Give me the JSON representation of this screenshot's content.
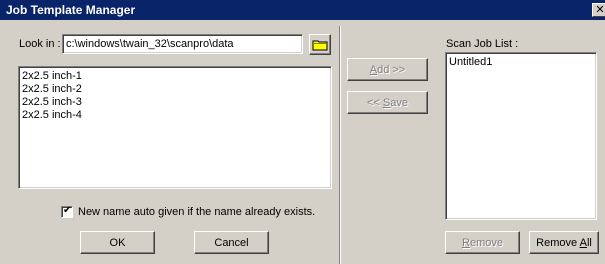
{
  "window": {
    "title": "Job Template Manager",
    "close_glyph": "✕"
  },
  "look_in": {
    "label": "Look in :",
    "path": "c:\\windows\\twain_32\\scanpro\\data",
    "folder_icon": "folder-icon"
  },
  "template_list": {
    "items": [
      "2x2.5 inch-1",
      "2x2.5 inch-2",
      "2x2.5 inch-3",
      "2x2.5 inch-4"
    ]
  },
  "auto_name": {
    "checked": true,
    "check_glyph": "✔",
    "label": "New name auto given if the name already exists."
  },
  "buttons": {
    "ok": "OK",
    "cancel": "Cancel",
    "add": {
      "prefix": "",
      "accel": "A",
      "rest": "dd >>"
    },
    "save": {
      "prefix": "<< ",
      "accel": "S",
      "rest": "ave"
    },
    "remove": {
      "prefix": "",
      "accel": "R",
      "rest": "emove"
    },
    "remove_all": {
      "prefix": "Remove ",
      "accel": "A",
      "rest": "ll"
    }
  },
  "scan_job_list": {
    "title": "Scan Job List :",
    "items": [
      "Untitled1"
    ]
  },
  "colors": {
    "titlebar": "#0a246a",
    "face": "#d4d0c8",
    "disabled_text": "#808080"
  }
}
